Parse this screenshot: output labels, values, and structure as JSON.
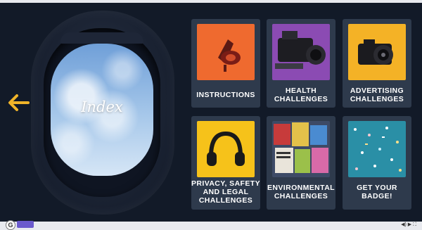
{
  "window": {
    "title": "Index"
  },
  "cards": [
    {
      "label": "INSTRUCTIONS",
      "thumb_color": "#ef6a2f"
    },
    {
      "label": "HEALTH CHALLENGES",
      "thumb_color": "#8b4bb3"
    },
    {
      "label": "ADVERTISING CHALLENGES",
      "thumb_color": "#f4b226"
    },
    {
      "label": "PRIVACY, SAFETY AND LEGAL CHALLENGES",
      "thumb_color": "#f6c21a"
    },
    {
      "label": "ENVIRONMENTAL CHALLENGES",
      "thumb_color": "#3d4a66"
    },
    {
      "label": "GET YOUR BADGE!",
      "thumb_color": "#2a8fa6"
    }
  ],
  "colors": {
    "background": "#121a28",
    "card": "#2e3a4c",
    "accent_arrow": "#f0b429"
  },
  "icons": [
    "arrow-left-icon",
    "megaphone-icon",
    "camera-icon",
    "headphones-icon",
    "newspaper-icon",
    "confetti-icon",
    "player-volume-icon",
    "player-play-icon",
    "player-fullscreen-icon"
  ]
}
